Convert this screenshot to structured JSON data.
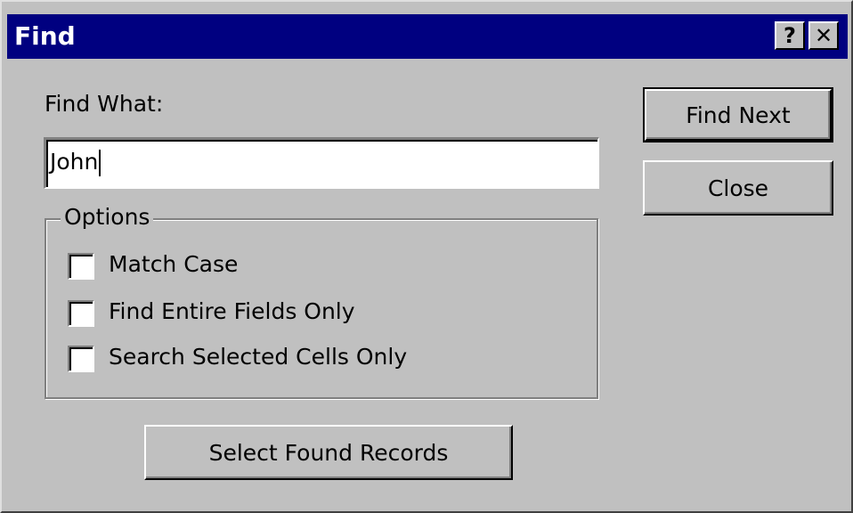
{
  "window": {
    "title": "Find",
    "help_label": "?",
    "close_label": "✕"
  },
  "find_what": {
    "label": "Find What:",
    "value": "John"
  },
  "options": {
    "legend": "Options",
    "items": [
      {
        "label": "Match Case",
        "checked": false
      },
      {
        "label": "Find Entire Fields Only",
        "checked": false
      },
      {
        "label": "Search Selected Cells Only",
        "checked": false
      }
    ]
  },
  "buttons": {
    "find_next": "Find Next",
    "close": "Close",
    "select_found": "Select Found Records"
  },
  "colors": {
    "titlebar": "#000080",
    "face": "#c0c0c0"
  }
}
